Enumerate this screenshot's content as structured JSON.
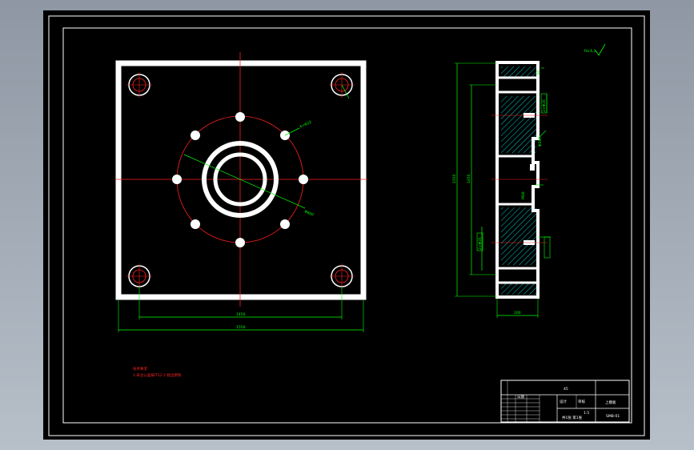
{
  "window": {
    "background_gradient": [
      "#8e97a3",
      "#b7bfc9"
    ],
    "canvas_color": "#000000"
  },
  "colors": {
    "border": "#ffffff",
    "part": "#ffffff",
    "centerline": "#ff2020",
    "dimension": "#00ff00",
    "hatch": "#00ffff",
    "note": "#ff2020"
  },
  "drawing": {
    "dim_front_inner_width": "1450",
    "dim_front_outer_width": "1550",
    "dim_side_height_outer": "1550",
    "dim_side_height_inner": "1450",
    "dim_side_thickness": "200",
    "dim_bolt_circle": "Φ600",
    "dim_hole": "4×Φ22",
    "dim_counterbore_top": "2×Φ35",
    "dim_counterbore_bottom": "2×Φ35",
    "dim_side_small": "60",
    "dim_side_mid": "Φ160",
    "dim_side_step": "M16",
    "roughness_mark": "Ra 6.3"
  },
  "notes": {
    "title": "技术要求",
    "line1": "1.未注公差按IT12   2.锐边倒钝"
  },
  "title_block": {
    "part_name": "上模板",
    "drawing_no": "SMB-01",
    "material": "45",
    "scale": "1:5",
    "designer": "设计",
    "checker": "审核",
    "date": "日期",
    "sheet": "共1张 第1张"
  }
}
